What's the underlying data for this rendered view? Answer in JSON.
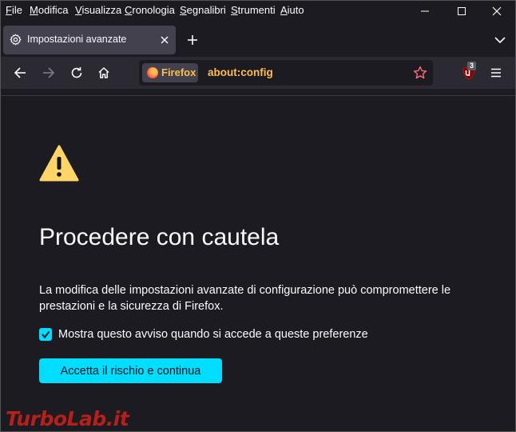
{
  "menubar": {
    "items": [
      {
        "label": "File"
      },
      {
        "label": "Modifica"
      },
      {
        "label": "Visualizza"
      },
      {
        "label": "Cronologia"
      },
      {
        "label": "Segnalibri"
      },
      {
        "label": "Strumenti"
      },
      {
        "label": "Aiuto"
      }
    ]
  },
  "tab": {
    "title": "Impostazioni avanzate",
    "icon": "gear-icon"
  },
  "toolbar": {
    "identity_label": "Firefox",
    "url": "about:config",
    "extension_badge": "3"
  },
  "content": {
    "title": "Procedere con cautela",
    "description": "La modifica delle impostazioni avanzate di configurazione può compromettere le prestazioni e la sicurezza di Firefox.",
    "checkbox_label": "Mostra questo avviso quando si accede a queste preferenze",
    "checkbox_checked": true,
    "accept_button": "Accetta il rischio e continua"
  },
  "watermark": "TurboLab.it",
  "colors": {
    "accent": "#00ddff",
    "warning": "#ffd567",
    "url_highlight": "#ffbd4f",
    "background": "#1c1b22",
    "toolbar": "#2b2a33"
  }
}
